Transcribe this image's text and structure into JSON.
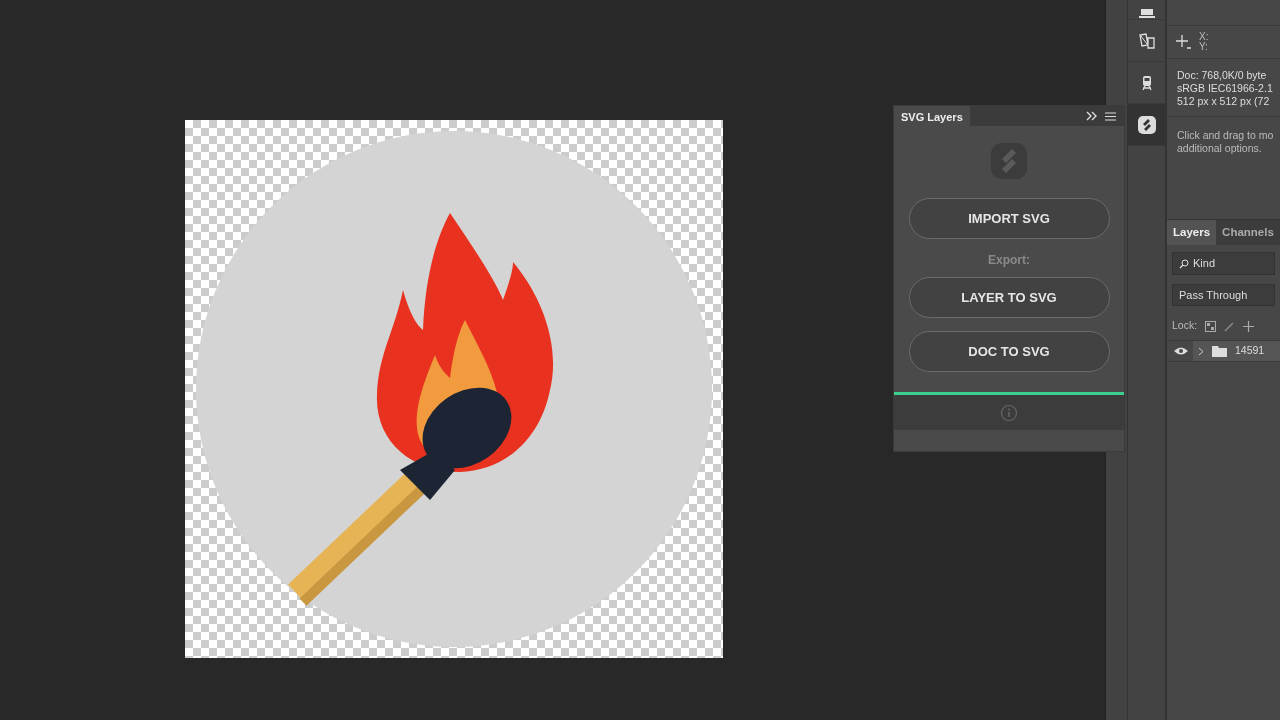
{
  "svg_panel": {
    "title": "SVG Layers",
    "import_button": "IMPORT SVG",
    "export_label": "Export:",
    "export_buttons": [
      "LAYER TO SVG",
      "DOC TO SVG"
    ],
    "progress": {
      "level": 1
    }
  },
  "tool_strip": [
    {
      "kind": "tray",
      "selected": false
    },
    {
      "kind": "shapes",
      "selected": false
    },
    {
      "kind": "train",
      "selected": false
    },
    {
      "kind": "logo",
      "selected": true
    }
  ],
  "info": {
    "x_label": "X:",
    "y_label": "Y:",
    "doc_lines": [
      "Doc: 768,0K/0 byte",
      "sRGB IEC61966-2.1",
      "512 px x 512 px (72"
    ],
    "hint_lines": [
      "Click and drag to mo",
      "additional options."
    ]
  },
  "layers_panel": {
    "tabs": [
      {
        "label": "Layers",
        "selected": true
      },
      {
        "label": "Channels",
        "selected": false
      }
    ],
    "filter": "Kind",
    "blend_mode": "Pass Through",
    "lock_label": "Lock:",
    "layers": [
      {
        "name": "14591",
        "visible": true,
        "kind": "group"
      }
    ]
  }
}
